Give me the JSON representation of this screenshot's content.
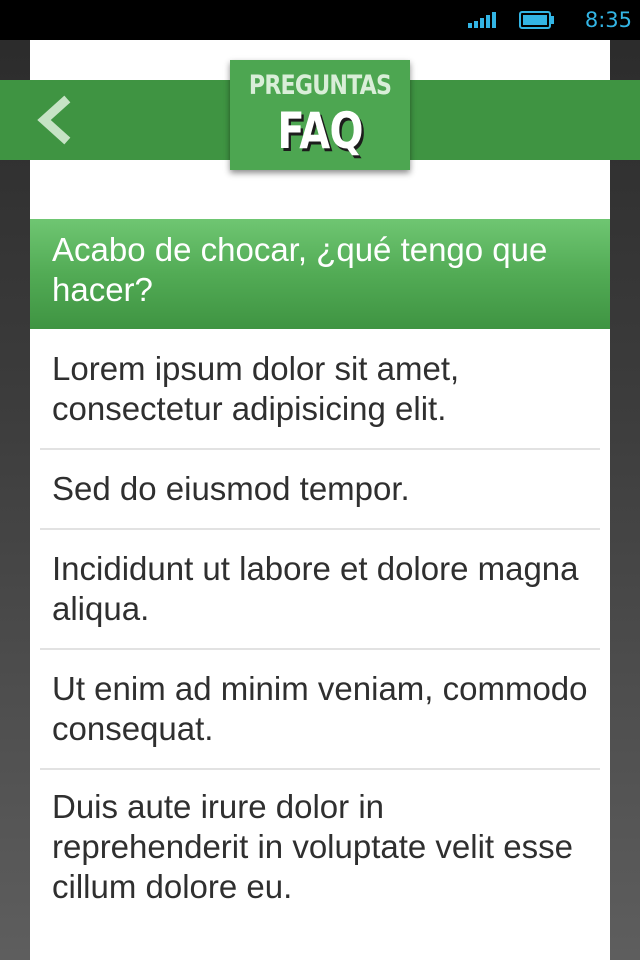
{
  "status_bar": {
    "time": "8:35",
    "accent_color": "#33b5e5"
  },
  "header": {
    "title_small": "PREGUNTAS",
    "title_big": "FAQ",
    "back_icon": "chevron-left-icon",
    "brand_color": "#3f9442"
  },
  "faq": {
    "selected": "Acabo de chocar, ¿qué tengo que hacer?",
    "items": [
      "Lorem ipsum dolor sit amet, consectetur adipisicing elit.",
      "Sed do eiusmod tempor.",
      "Incididunt ut labore et dolore magna aliqua.",
      "Ut enim ad minim veniam, commodo consequat.",
      "Duis aute irure dolor in reprehenderit in voluptate velit esse cillum dolore eu."
    ]
  }
}
